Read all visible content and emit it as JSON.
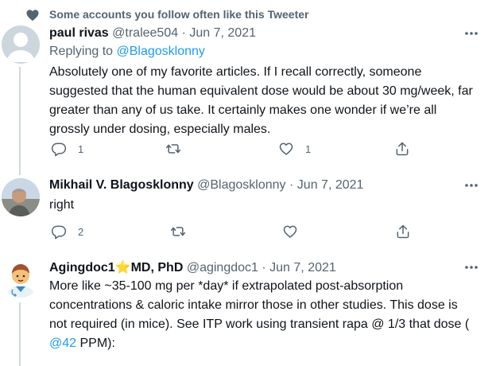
{
  "social_context": {
    "text": "Some accounts you follow often like this Tweeter",
    "icon": "heart-icon"
  },
  "tweets": [
    {
      "name": "paul rivas",
      "handle": "@tralee504",
      "separator": "·",
      "date": "Jun 7, 2021",
      "reply_prefix": "Replying to",
      "reply_handle": "@Blagosklonny",
      "text_lines": [
        "Absolutely one of my favorite articles. If I recall correctly, someone",
        "suggested that the human equivalent dose would be about 30 mg/week, far",
        "greater than any of us take. It certainly makes one wonder if we’re all",
        "grossly under dosing, especially males."
      ],
      "replies": "1",
      "retweets": "",
      "likes": "1"
    },
    {
      "name": "Mikhail V. Blagosklonny",
      "handle": "@Blagosklonny",
      "separator": "·",
      "date": "Jun 7, 2021",
      "text_lines": [
        "right"
      ],
      "replies": "2",
      "retweets": "",
      "likes": ""
    },
    {
      "name": "Agingdoc1",
      "name_emoji": "⭐",
      "name_suffix": "MD, PhD",
      "handle": "@agingdoc1",
      "separator": "·",
      "date": "Jun 7, 2021",
      "text_lines": [
        "More like ~35-100 mg per *day* if extrapolated post-absorption",
        "concentrations & caloric intake mirror those in other studies. This dose is",
        "not required (in mice). See ITP work using transient rapa @ 1/3 that dose ("
      ],
      "last_line_link": "@42",
      "last_line_rest": " PPM):"
    }
  ],
  "colors": {
    "accent": "#1d9bf0",
    "muted": "#536471",
    "text": "#0f1419",
    "line": "#cfd9de"
  }
}
